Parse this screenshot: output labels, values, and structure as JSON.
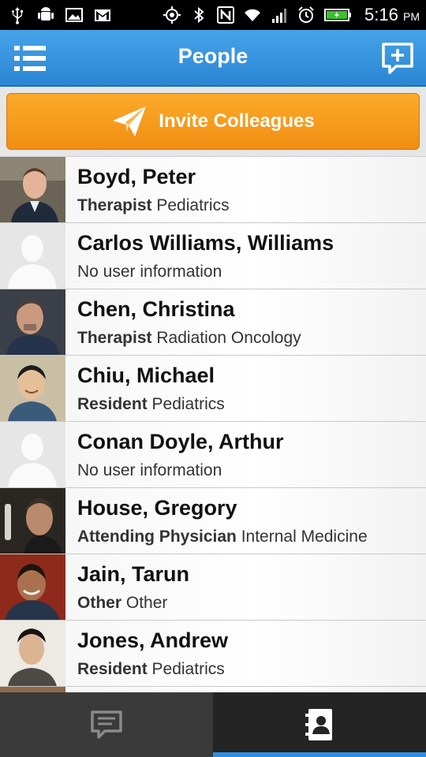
{
  "status_bar": {
    "time": "5:16",
    "ampm": "PM",
    "left_icons": [
      "usb-icon",
      "android-debug-icon",
      "image-icon",
      "gmail-icon"
    ],
    "right_icons": [
      "gps-icon",
      "bluetooth-icon",
      "nfc-icon",
      "wifi-icon",
      "signal-icon",
      "alarm-icon",
      "battery-icon"
    ]
  },
  "action_bar": {
    "title": "People",
    "menu_icon": "list-icon",
    "compose_icon": "new-message-icon"
  },
  "invite": {
    "label": "Invite Colleagues",
    "icon": "paper-plane-icon",
    "color": "#f5991c"
  },
  "people": [
    {
      "name": "Boyd, Peter",
      "role": "Therapist",
      "detail": "Pediatrics",
      "has_photo": true
    },
    {
      "name": "Carlos Williams, Williams",
      "role": "",
      "detail": "No user information",
      "has_photo": false
    },
    {
      "name": "Chen, Christina",
      "role": "Therapist",
      "detail": "Radiation Oncology",
      "has_photo": true
    },
    {
      "name": "Chiu, Michael",
      "role": "Resident",
      "detail": "Pediatrics",
      "has_photo": true
    },
    {
      "name": "Conan Doyle, Arthur",
      "role": "",
      "detail": "No user information",
      "has_photo": false
    },
    {
      "name": "House, Gregory",
      "role": "Attending Physician",
      "detail": "Internal Medicine",
      "has_photo": true
    },
    {
      "name": "Jain, Tarun",
      "role": "Other",
      "detail": "Other",
      "has_photo": true
    },
    {
      "name": "Jones, Andrew",
      "role": "Resident",
      "detail": "Pediatrics",
      "has_photo": true
    }
  ],
  "tabs": [
    {
      "icon": "chat-icon",
      "selected": false
    },
    {
      "icon": "contacts-icon",
      "selected": true
    }
  ],
  "colors": {
    "action_bar": "#2f8de0",
    "tab_indicator": "#2f8de0"
  }
}
